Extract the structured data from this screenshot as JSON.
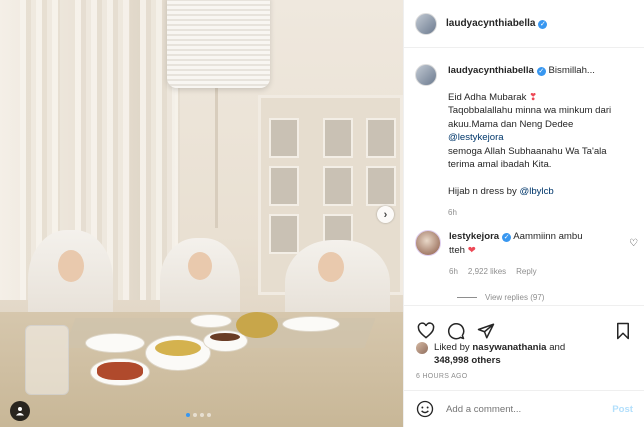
{
  "post": {
    "username": "laudyacynthiabella",
    "verified_icon": "verified-badge-icon"
  },
  "caption": {
    "username": "laudyacynthiabella",
    "first_line": "Bismillah...",
    "lines": [
      "Eid Adha Mubarak",
      "Taqobbalallahu minna wa minkum dari",
      "akuu.Mama dan Neng Dedee",
      "@lestykejora",
      "semoga Allah Subhaanahu Wa Ta'ala",
      "terima amal ibadah Kita."
    ],
    "credit_prefix": "Hijab n dress by ",
    "credit_mention": "@lbylcb",
    "time": "6h"
  },
  "comment": {
    "username": "lestykejora",
    "text_1": "Aammiinn ambu",
    "text_2": "tteh",
    "time": "6h",
    "likes": "2,922 likes",
    "reply_label": "Reply",
    "view_replies": "View replies (97)"
  },
  "likes_info": {
    "prefix": "Liked by ",
    "user": "nasywanathania",
    "middle": " and",
    "count": "348,998 others"
  },
  "posted_ago": "6 HOURS AGO",
  "add_comment": {
    "placeholder": "Add a comment...",
    "post_label": "Post"
  },
  "colors": {
    "accent": "#3897f0",
    "post_disabled": "#b2dffc",
    "meta_gray": "#8e8e8e",
    "heart_red": "#ed4956"
  }
}
